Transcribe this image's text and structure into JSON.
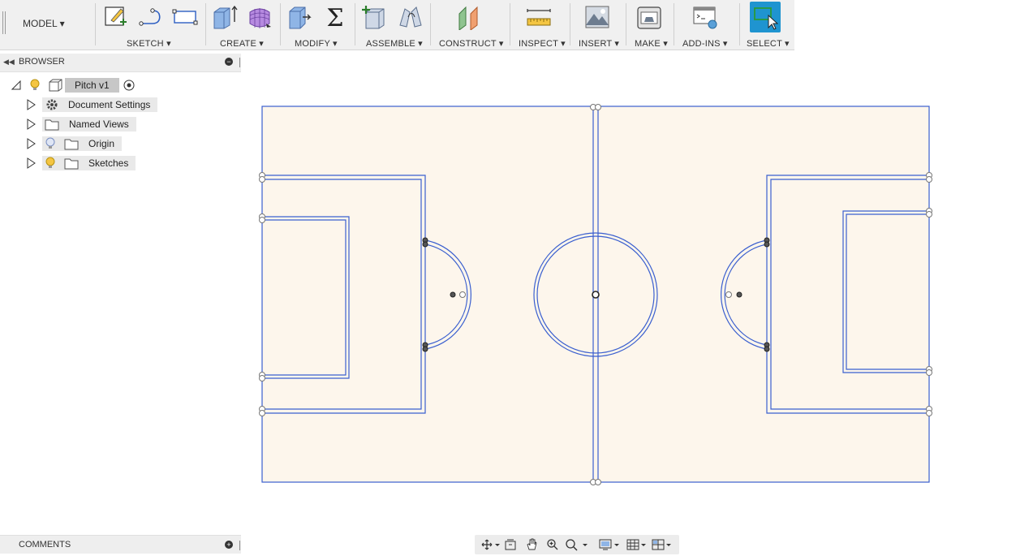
{
  "toolbar": {
    "workspace": "MODEL ▾",
    "groups": {
      "sketch": "SKETCH ▾",
      "create": "CREATE ▾",
      "modify": "MODIFY ▾",
      "assemble": "ASSEMBLE ▾",
      "construct": "CONSTRUCT ▾",
      "inspect": "INSPECT ▾",
      "insert": "INSERT ▾",
      "make": "MAKE ▾",
      "addins": "ADD-INS ▾",
      "select": "SELECT ▾"
    },
    "icons": [
      "create-sketch-icon",
      "line-icon",
      "rectangle-icon",
      "extrude-icon",
      "form-icon",
      "press-pull-icon",
      "sigma-icon",
      "new-component-icon",
      "joint-icon",
      "offset-plane-icon",
      "measure-icon",
      "insert-image-icon",
      "3d-print-icon",
      "scripts-icon",
      "select-icon"
    ],
    "select_color": "#1f94d0"
  },
  "browser": {
    "title": "BROWSER",
    "root": {
      "label": "Pitch v1"
    },
    "items": [
      {
        "label": "Document Settings",
        "icon": "gear-icon"
      },
      {
        "label": "Named Views",
        "icon": "folder-icon"
      },
      {
        "label": "Origin",
        "icon": "folder-icon",
        "visibility": "off"
      },
      {
        "label": "Sketches",
        "icon": "folder-icon",
        "visibility": "on"
      }
    ]
  },
  "comments": {
    "title": "COMMENTS"
  },
  "canvas": {
    "sketch": "football pitch",
    "fill_color": "#fdf6ec",
    "line_color": "#3a5fcf"
  },
  "navbar": {
    "icons": [
      "orbit-icon",
      "look-at-icon",
      "pan-icon",
      "zoom-icon",
      "zoom-window-icon",
      "display-settings-icon",
      "grid-icon",
      "viewports-icon"
    ]
  }
}
